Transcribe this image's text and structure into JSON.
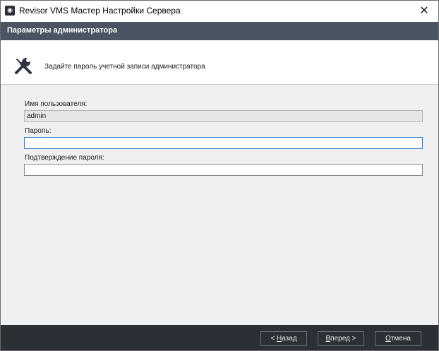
{
  "window": {
    "title": "Revisor VMS Мастер Настройки Сервера",
    "app_icon": "camera-icon",
    "close_glyph": "✕"
  },
  "header": {
    "section_title": "Параметры администратора"
  },
  "intro": {
    "icon": "tools-icon",
    "text": "Задайте пароль учетной записи администратора"
  },
  "form": {
    "username_label": "Имя пользователя:",
    "username_value": "admin",
    "password_label": "Пароль:",
    "password_value": "",
    "confirm_label": "Подтверждение пароля:",
    "confirm_value": ""
  },
  "footer": {
    "back_prefix": "< ",
    "back_accel": "Н",
    "back_rest": "азад",
    "next_accel": "В",
    "next_rest": "перед >",
    "cancel_accel": "О",
    "cancel_rest": "тмена"
  },
  "colors": {
    "header_bg": "#4b5463",
    "footer_bg": "#2b2f36",
    "form_bg": "#f0f0f0",
    "focus_border": "#2b7bd3"
  }
}
